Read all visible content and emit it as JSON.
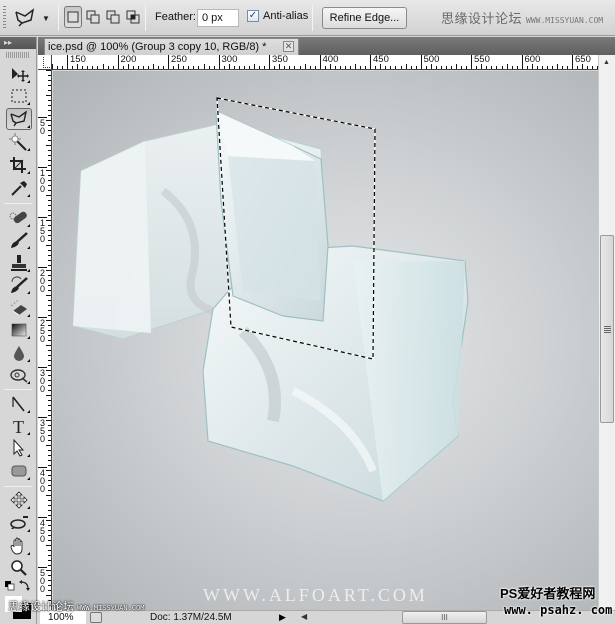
{
  "options_bar": {
    "tool_preset_icon": "polygonal-lasso-icon",
    "selection_modes": [
      {
        "name": "new-selection",
        "active": true
      },
      {
        "name": "add-to-selection",
        "active": false
      },
      {
        "name": "subtract-from-selection",
        "active": false
      },
      {
        "name": "intersect-with-selection",
        "active": false
      }
    ],
    "feather_label": "Feather:",
    "feather_value": "0 px",
    "anti_alias_label": "Anti-alias",
    "anti_alias_checked": "✓",
    "refine_edge_label": "Refine Edge...",
    "watermark_text": "思缘设计论坛",
    "watermark_url": "WWW.MISSYUAN.COM"
  },
  "toolbox": {
    "header": "▸▸",
    "tools": [
      {
        "name": "move-tool",
        "icon": "move-icon"
      },
      {
        "name": "marquee-tool",
        "icon": "rect-marquee-icon"
      },
      {
        "name": "polygonal-lasso-tool",
        "icon": "polygonal-lasso-icon",
        "active": true
      },
      {
        "name": "magic-wand-tool",
        "icon": "magic-wand-icon"
      },
      {
        "name": "crop-tool",
        "icon": "crop-icon"
      },
      {
        "name": "eyedropper-tool",
        "icon": "eyedropper-icon"
      },
      {
        "name": "healing-brush-tool",
        "icon": "bandage-icon"
      },
      {
        "name": "brush-tool",
        "icon": "brush-icon"
      },
      {
        "name": "clone-stamp-tool",
        "icon": "stamp-icon"
      },
      {
        "name": "history-brush-tool",
        "icon": "history-brush-icon"
      },
      {
        "name": "eraser-tool",
        "icon": "eraser-icon"
      },
      {
        "name": "gradient-tool",
        "icon": "gradient-icon"
      },
      {
        "name": "blur-tool",
        "icon": "drop-icon"
      },
      {
        "name": "dodge-tool",
        "icon": "dodge-icon"
      },
      {
        "name": "pen-tool",
        "icon": "pen-icon"
      },
      {
        "name": "type-tool",
        "icon": "type-icon"
      },
      {
        "name": "path-selection-tool",
        "icon": "arrow-icon"
      },
      {
        "name": "shape-tool",
        "icon": "rounded-rect-icon"
      },
      {
        "name": "3d-rotate-tool",
        "icon": "3d-rotate-icon"
      },
      {
        "name": "3d-orbit-tool",
        "icon": "3d-orbit-icon"
      },
      {
        "name": "hand-tool",
        "icon": "hand-icon"
      },
      {
        "name": "zoom-tool",
        "icon": "magnifier-icon"
      }
    ]
  },
  "document": {
    "tab_title": "ice.psd @ 100% (Group 3 copy 10, RGB/8) *",
    "close_glyph": "✕"
  },
  "rulers": {
    "horizontal": [
      "150",
      "200",
      "250",
      "300",
      "350",
      "400",
      "450",
      "500",
      "550",
      "600",
      "650"
    ],
    "vertical": [
      "50",
      "100",
      "150",
      "200",
      "250",
      "300",
      "350",
      "400",
      "450",
      "500"
    ]
  },
  "canvas": {
    "watermark": "WWW.ALFOART.COM"
  },
  "status_bar": {
    "zoom": "100%",
    "doc_info": "Doc: 1.37M/24.5M",
    "arrow": "▶",
    "scroll_left": "◀",
    "hscroll_grip": "III"
  },
  "watermarks": {
    "bottom_left_text": "思缘设计论坛",
    "bottom_left_url": "WWW.MISSYUAN.COM",
    "bottom_right_line1": "PS爱好者教程网",
    "bottom_right_line2": "www. psahz. com"
  }
}
